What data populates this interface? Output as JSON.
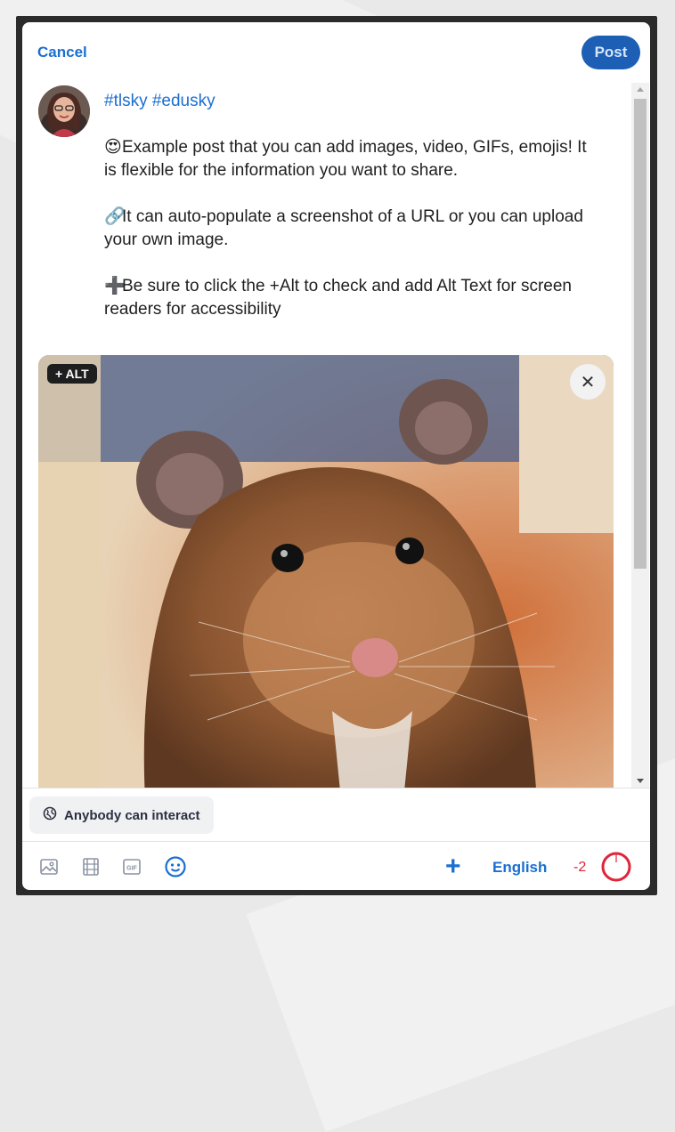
{
  "header": {
    "cancel_label": "Cancel",
    "post_label": "Post"
  },
  "post": {
    "tags": "#tlsky #edusky",
    "paragraph1_emoji": "😍",
    "paragraph1": "Example post that you can add images, video, GIFs, emojis! It is flexible for the information you want to share.",
    "paragraph2_emoji": "🔗",
    "paragraph2": "It can auto-populate a screenshot of a URL or you can upload your own image.",
    "paragraph3_emoji": "➕",
    "paragraph3": "Be sure to click the +Alt to check and add Alt Text for screen readers for accessibility"
  },
  "image": {
    "alt_button_label": "+ ALT",
    "close_glyph": "✕"
  },
  "interaction": {
    "label": "Anybody can interact"
  },
  "toolbar": {
    "language_label": "English",
    "char_count": "-2",
    "plus_glyph": "+",
    "gif_label": "GIF",
    "icons": [
      "image-icon",
      "video-icon",
      "gif-icon",
      "emoji-icon"
    ]
  },
  "colors": {
    "accent": "#1a6fd1",
    "post_button": "#1c5fb5",
    "error": "#e0243a"
  }
}
